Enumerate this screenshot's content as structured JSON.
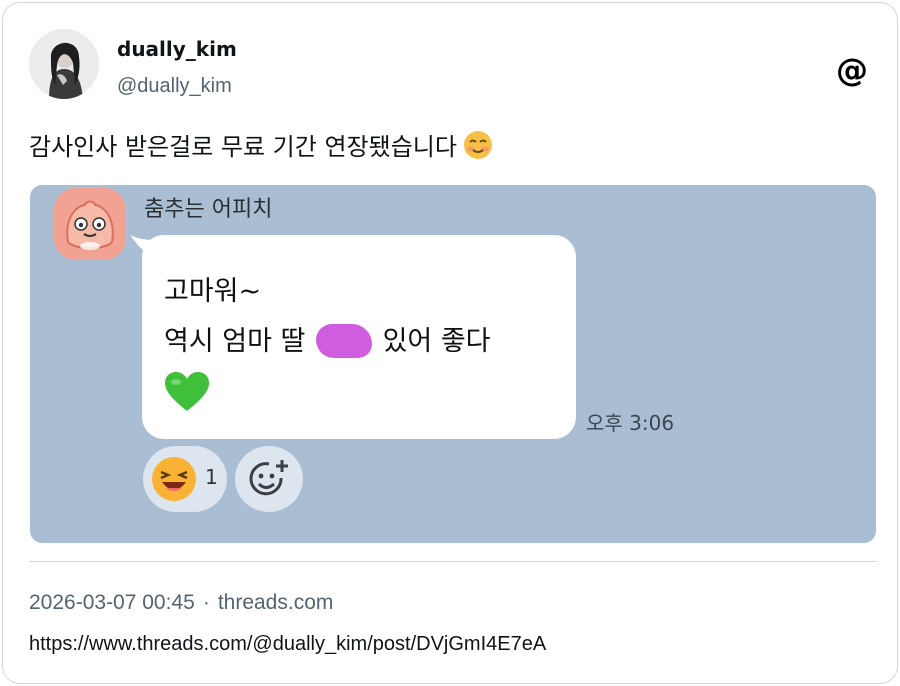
{
  "author": {
    "display_name": "dually_kim",
    "handle": "@dually_kim"
  },
  "post": {
    "text": "감사인사 받은걸로 무료 기간 연장됐습니다",
    "emoji": "smiling-face-icon"
  },
  "chat": {
    "sender_name": "춤추는 어피치",
    "message_line1": "고마워~",
    "message_line2_before": "역시 엄마 딸",
    "message_line2_after": "있어 좋다",
    "heart": "green-heart-icon",
    "time": "오후 3:06",
    "reaction_count": "1",
    "background_color": "#a9bed3"
  },
  "footer": {
    "timestamp": "2026-03-07 00:45",
    "separator": "·",
    "source": "threads.com",
    "url": "https://www.threads.com/@dually_kim/post/DVjGmI4E7eA"
  }
}
